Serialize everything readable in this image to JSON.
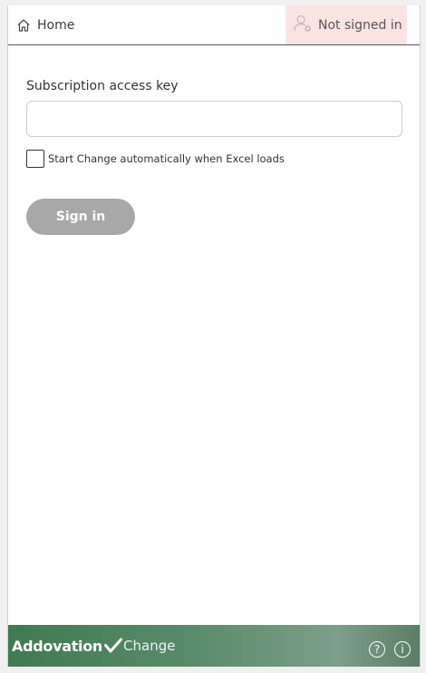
{
  "header": {
    "home_label": "Home",
    "home_icon": "home-icon",
    "user_status_label": "Not signed in",
    "user_status_icon": "user-gear-icon",
    "user_status_bg": "#fbe3e4"
  },
  "form": {
    "key_label": "Subscription access key",
    "key_value": "",
    "key_placeholder": "",
    "autostart_label": "Start Change automatically when Excel loads",
    "autostart_checked": false,
    "sign_in_label": "Sign in",
    "sign_in_color": "#a8a8a8"
  },
  "footer": {
    "brand_name": "Addovation",
    "product_name": "Change",
    "help_icon": "help-icon",
    "help_symbol": "?",
    "info_icon": "info-icon",
    "info_symbol": "i",
    "accent_color": "#4a8258"
  }
}
